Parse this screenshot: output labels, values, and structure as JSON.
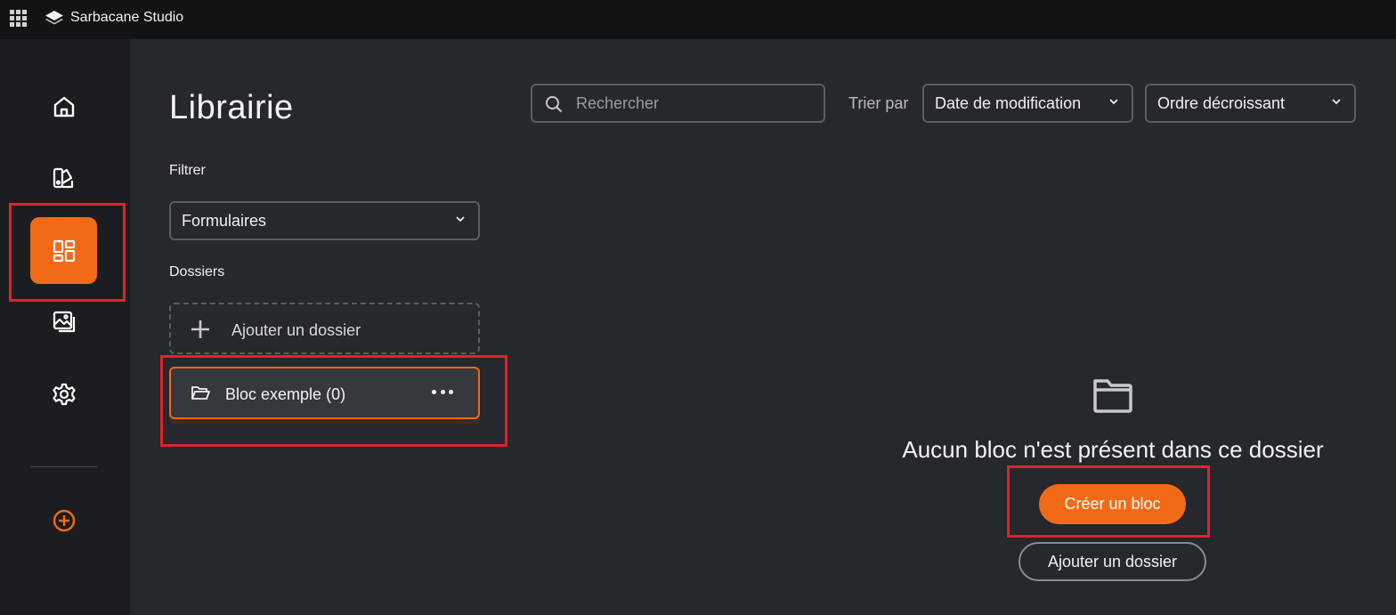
{
  "app": {
    "title": "Sarbacane Studio"
  },
  "sidebar": {
    "items": [
      {
        "icon": "home-icon"
      },
      {
        "icon": "templates-icon"
      },
      {
        "icon": "blocks-icon",
        "active": true
      },
      {
        "icon": "gallery-icon"
      },
      {
        "icon": "settings-icon"
      }
    ],
    "create_icon": "plus-circle-icon",
    "accent": "#f26a17"
  },
  "library": {
    "title": "Librairie",
    "filter_label": "Filtrer",
    "filter_value": "Formulaires",
    "folders_label": "Dossiers",
    "add_folder_label": "Ajouter un dossier",
    "folders": [
      {
        "name": "Bloc exemple",
        "count": "(0)"
      }
    ]
  },
  "toolbar": {
    "search_placeholder": "Rechercher",
    "sort_label": "Trier par",
    "sort_field": "Date de modification",
    "sort_order": "Ordre décroissant"
  },
  "empty_state": {
    "message": "Aucun bloc n'est présent dans ce dossier",
    "create_button": "Créer un bloc",
    "add_folder_button": "Ajouter un dossier"
  }
}
